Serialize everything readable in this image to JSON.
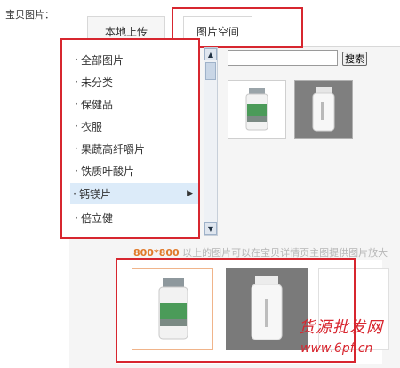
{
  "field_label": "宝贝图片：",
  "tabs": [
    {
      "label": "本地上传"
    },
    {
      "label": "图片空间"
    }
  ],
  "categories": [
    {
      "label": "全部图片"
    },
    {
      "label": "未分类"
    },
    {
      "label": "保健品"
    },
    {
      "label": "衣服"
    },
    {
      "label": "果蔬高纤嚼片"
    },
    {
      "label": "铁质叶酸片"
    },
    {
      "label": "钙镁片"
    },
    {
      "label": "倍立健"
    }
  ],
  "active_category": "钙镁片",
  "search": {
    "placeholder": "",
    "button_label": "搜索"
  },
  "note": {
    "highlight": "800*800",
    "text": " 以上的图片可以在宝贝详情页主图提供图片放大"
  },
  "watermark": {
    "title": "货源批发网",
    "url": "www.6pf.cn"
  },
  "colors": {
    "highlight_red": "#d7262f",
    "active_item_bg": "#dcebf9",
    "note_orange": "#e07a2a"
  }
}
